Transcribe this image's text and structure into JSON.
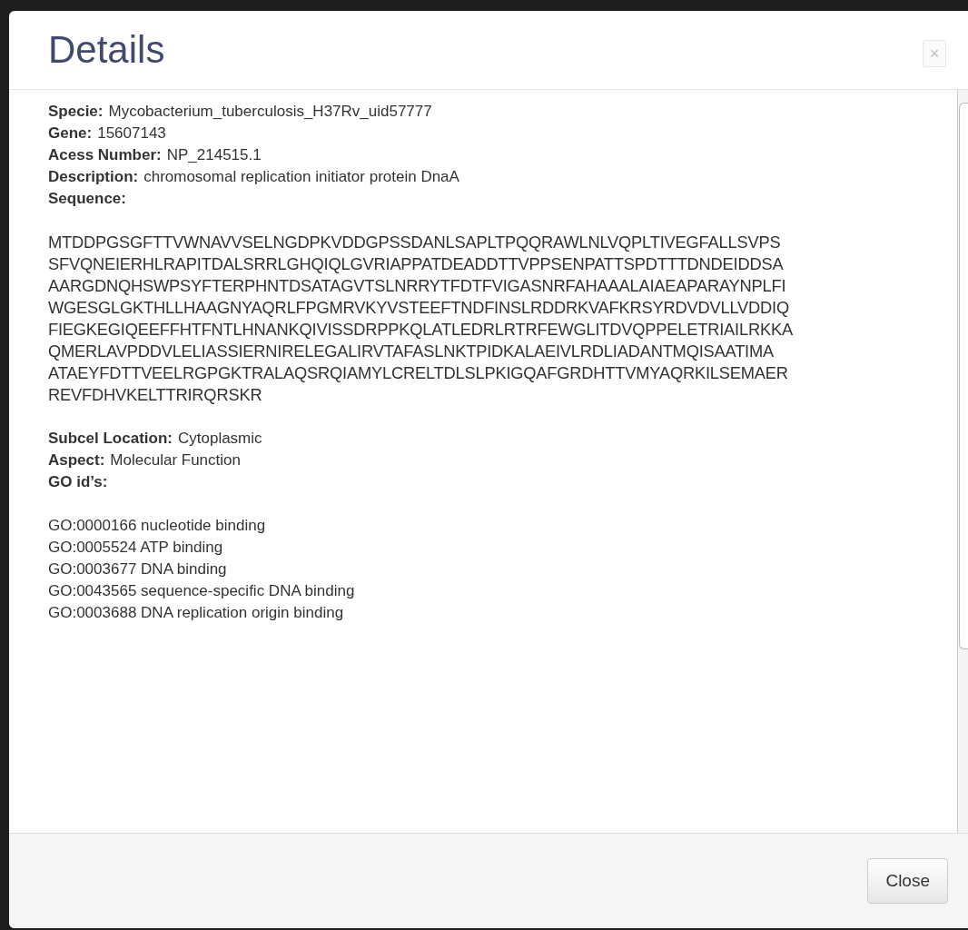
{
  "dialog": {
    "title": "Details",
    "close_glyph": "×"
  },
  "fields": [
    {
      "label": "Specie:",
      "value": "Mycobacterium_tuberculosis_H37Rv_uid57777"
    },
    {
      "label": "Gene:",
      "value": "15607143"
    },
    {
      "label": "Acess Number:",
      "value": "NP_214515.1"
    },
    {
      "label": "Description:",
      "value": "chromosomal replication initiator protein DnaA"
    },
    {
      "label": "Sequence:"
    }
  ],
  "sequence": [
    "MTDDPGSGFTTVWNAVVSELNGDPKVDDGPSSDANLSAPLTPQQRAWLNLVQPLTIVEGFALLSVPS",
    "SFVQNEIERHLRAPITDALSRRLGHQIQLGVRIAPPATDEADDTTVPPSENPATTSPDTTTDNDEIDDSA",
    "AARGDNQHSWPSYFTERPHNTDSATAGVTSLNRRYTFDTFVIGASNRFAHAAALAIAEAPARAYNPLFI",
    "WGESGLGKTHLLHAAGNYAQRLFPGMRVKYVSTEEFTNDFINSLRDDRKVAFKRSYRDVDVLLVDDIQ",
    "FIEGKEGIQEEFFHTFNTLHNANKQIVISSDRPPKQLATLEDRLRTRFEWGLITDVQPPELETRIAILRKKA",
    "QMERLAVPDDVLELIASSIERNIRELEGALIRVTAFASLNKTPIDKALAEIVLRDLIADANTMQISAATIMA",
    "ATAEYFDTTVEELRGPGKTRALAQSRQIAMYLCRELTDLSLPKIGQAFGRDHTTVMYAQRKILSEMAER",
    "REVFDHVKELTTRIRQRSKR"
  ],
  "fields_2": [
    {
      "label": "Subcel Location:",
      "value": "Cytoplasmic"
    },
    {
      "label": "Aspect:",
      "value": "Molecular Function"
    },
    {
      "label": "GO id’s:"
    }
  ],
  "go_ids": [
    "GO:0000166 nucleotide binding",
    "GO:0005524 ATP binding",
    "GO:0003677 DNA binding",
    "GO:0043565 sequence-specific DNA binding",
    "GO:0003688 DNA replication origin binding"
  ],
  "footer": {
    "buttons": [
      "Close"
    ]
  }
}
